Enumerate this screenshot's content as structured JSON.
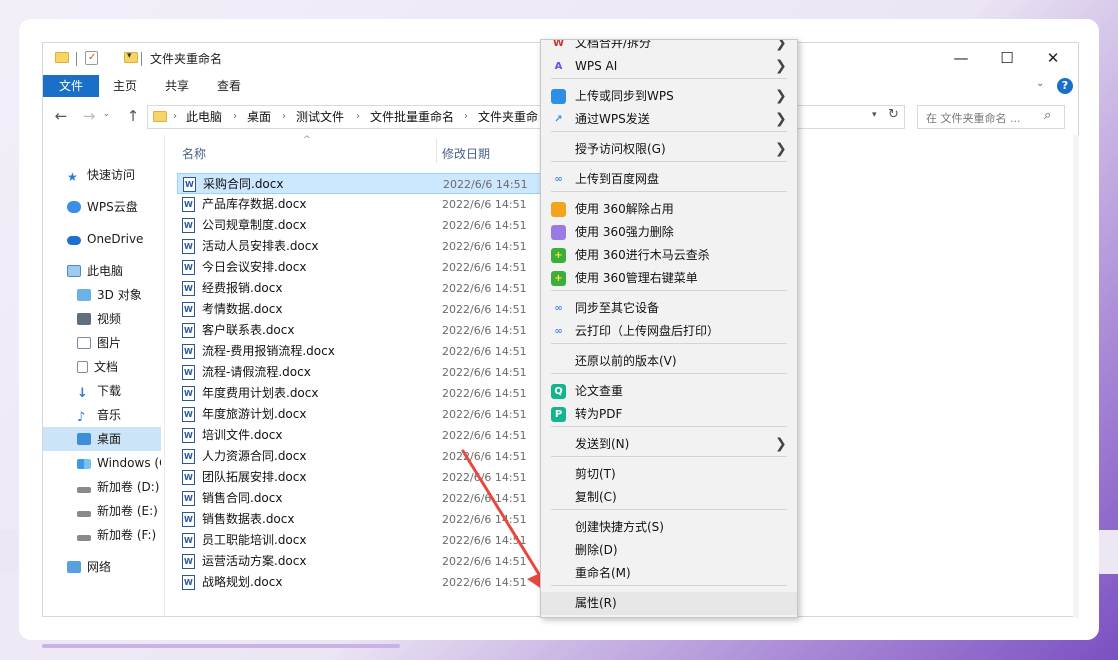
{
  "window": {
    "title": "文件夹重命名",
    "controls": {
      "minimize": "—",
      "maximize": "☐",
      "close": "✕"
    }
  },
  "ribbon": {
    "tabs": [
      "文件",
      "主页",
      "共享",
      "查看"
    ],
    "help": "?"
  },
  "addressbar": {
    "crumbs": [
      "此电脑",
      "桌面",
      "测试文件",
      "文件批量重命名",
      "文件夹重命"
    ],
    "search_placeholder": "在 文件夹重命名 ..."
  },
  "sidebar": {
    "items": [
      "快速访问",
      "WPS云盘",
      "OneDrive",
      "此电脑",
      "3D 对象",
      "视频",
      "图片",
      "文档",
      "下载",
      "音乐",
      "桌面",
      "Windows (C",
      "新加卷 (D:)",
      "新加卷 (E:)",
      "新加卷 (F:)",
      "网络"
    ]
  },
  "filelist": {
    "headers": {
      "name": "名称",
      "date": "修改日期"
    },
    "files": [
      {
        "name": "采购合同.docx",
        "date": "2022/6/6 14:51"
      },
      {
        "name": "产品库存数据.docx",
        "date": "2022/6/6 14:51"
      },
      {
        "name": "公司规章制度.docx",
        "date": "2022/6/6 14:51"
      },
      {
        "name": "活动人员安排表.docx",
        "date": "2022/6/6 14:51"
      },
      {
        "name": "今日会议安排.docx",
        "date": "2022/6/6 14:51"
      },
      {
        "name": "经费报销.docx",
        "date": "2022/6/6 14:51"
      },
      {
        "name": "考情数据.docx",
        "date": "2022/6/6 14:51"
      },
      {
        "name": "客户联系表.docx",
        "date": "2022/6/6 14:51"
      },
      {
        "name": "流程-费用报销流程.docx",
        "date": "2022/6/6 14:51"
      },
      {
        "name": "流程-请假流程.docx",
        "date": "2022/6/6 14:51"
      },
      {
        "name": "年度费用计划表.docx",
        "date": "2022/6/6 14:51"
      },
      {
        "name": "年度旅游计划.docx",
        "date": "2022/6/6 14:51"
      },
      {
        "name": "培训文件.docx",
        "date": "2022/6/6 14:51"
      },
      {
        "name": "人力资源合同.docx",
        "date": "2022/6/6 14:51"
      },
      {
        "name": "团队拓展安排.docx",
        "date": "2022/6/6 14:51"
      },
      {
        "name": "销售合同.docx",
        "date": "2022/6/6 14:51"
      },
      {
        "name": "销售数据表.docx",
        "date": "2022/6/6 14:51"
      },
      {
        "name": "员工职能培训.docx",
        "date": "2022/6/6 14:51"
      },
      {
        "name": "运营活动方案.docx",
        "date": "2022/6/6 14:51"
      },
      {
        "name": "战略规划.docx",
        "date": "2022/6/6 14:51"
      }
    ]
  },
  "context_menu": {
    "items": [
      {
        "label": "文档合并/拆分",
        "submenu": true
      },
      {
        "label": "WPS AI",
        "submenu": true
      },
      {
        "label": "上传或同步到WPS",
        "submenu": true
      },
      {
        "label": "通过WPS发送",
        "submenu": true
      },
      {
        "label": "授予访问权限(G)",
        "submenu": true
      },
      {
        "label": "上传到百度网盘",
        "submenu": false
      },
      {
        "label": "使用 360解除占用",
        "submenu": false
      },
      {
        "label": "使用 360强力删除",
        "submenu": false
      },
      {
        "label": "使用 360进行木马云查杀",
        "submenu": false
      },
      {
        "label": "使用 360管理右键菜单",
        "submenu": false
      },
      {
        "label": "同步至其它设备",
        "submenu": false
      },
      {
        "label": "云打印（上传网盘后打印）",
        "submenu": false
      },
      {
        "label": "还原以前的版本(V)",
        "submenu": false
      },
      {
        "label": "论文查重",
        "submenu": false
      },
      {
        "label": "转为PDF",
        "submenu": false
      },
      {
        "label": "发送到(N)",
        "submenu": true
      },
      {
        "label": "剪切(T)",
        "submenu": false
      },
      {
        "label": "复制(C)",
        "submenu": false
      },
      {
        "label": "创建快捷方式(S)",
        "submenu": false
      },
      {
        "label": "删除(D)",
        "submenu": false
      },
      {
        "label": "重命名(M)",
        "submenu": false
      },
      {
        "label": "属性(R)",
        "submenu": false
      }
    ],
    "arrow_glyph": "❯"
  },
  "colors": {
    "accent": "#1a6fc7",
    "annotation_arrow": "#e8473f",
    "selection": "#cce8ff"
  }
}
